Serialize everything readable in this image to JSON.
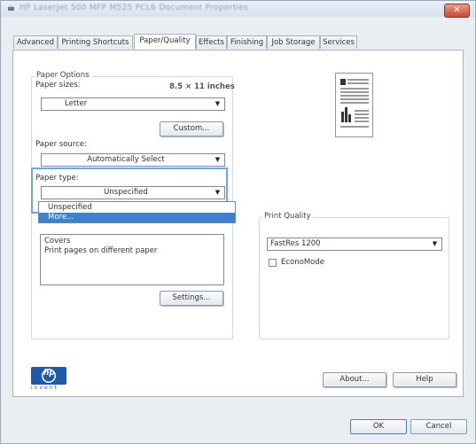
{
  "window": {
    "title": "HP LaserJet 500 MFP M525 PCL6 Document Properties",
    "close_symbol": "✕"
  },
  "tabs": [
    {
      "label": "Advanced"
    },
    {
      "label": "Printing Shortcuts"
    },
    {
      "label": "Paper/Quality"
    },
    {
      "label": "Effects"
    },
    {
      "label": "Finishing"
    },
    {
      "label": "Job Storage"
    },
    {
      "label": "Services"
    }
  ],
  "paper_options": {
    "group_label": "Paper Options",
    "sizes_label": "Paper sizes:",
    "size_value": "8.5 × 11 inches",
    "size_selected": "Letter",
    "custom_button": "Custom...",
    "source_label": "Paper source:",
    "source_selected": "Automatically Select",
    "type_label": "Paper type:",
    "type_selected": "Unspecified",
    "type_options": [
      "Unspecified",
      "More..."
    ],
    "covers_list": [
      "Covers",
      "Print pages on different paper"
    ],
    "settings_button": "Settings..."
  },
  "print_quality": {
    "group_label": "Print Quality",
    "selected": "FastRes 1200",
    "economode_label": "EconoMode",
    "economode_checked": false
  },
  "footer": {
    "brand_text": "hp",
    "brand_tagline": "invent",
    "about_button": "About...",
    "help_button": "Help"
  },
  "dialog": {
    "ok_button": "OK",
    "cancel_button": "Cancel"
  },
  "colors": {
    "accent_blue": "#3d7fd0",
    "highlight_border": "#6aa8dd",
    "close_red": "#c74a33",
    "hp_blue": "#1f5aa8"
  }
}
